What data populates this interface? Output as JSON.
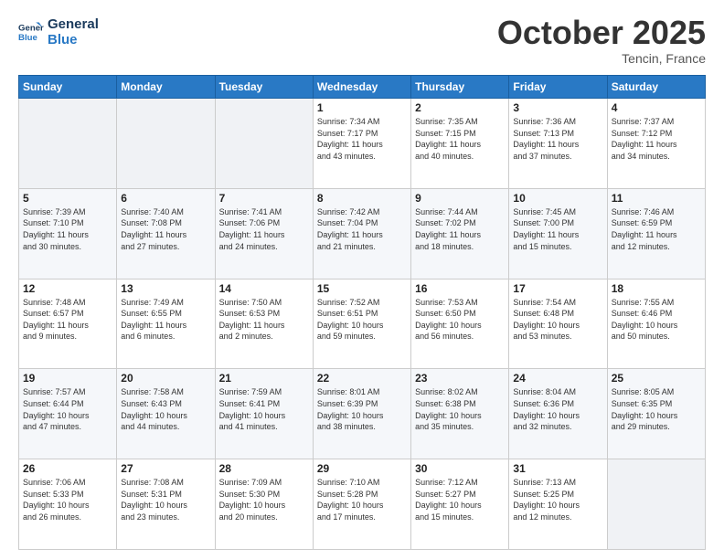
{
  "logo": {
    "line1": "General",
    "line2": "Blue"
  },
  "header": {
    "month": "October 2025",
    "location": "Tencin, France"
  },
  "weekdays": [
    "Sunday",
    "Monday",
    "Tuesday",
    "Wednesday",
    "Thursday",
    "Friday",
    "Saturday"
  ],
  "weeks": [
    [
      {
        "day": "",
        "info": ""
      },
      {
        "day": "",
        "info": ""
      },
      {
        "day": "",
        "info": ""
      },
      {
        "day": "1",
        "info": "Sunrise: 7:34 AM\nSunset: 7:17 PM\nDaylight: 11 hours\nand 43 minutes."
      },
      {
        "day": "2",
        "info": "Sunrise: 7:35 AM\nSunset: 7:15 PM\nDaylight: 11 hours\nand 40 minutes."
      },
      {
        "day": "3",
        "info": "Sunrise: 7:36 AM\nSunset: 7:13 PM\nDaylight: 11 hours\nand 37 minutes."
      },
      {
        "day": "4",
        "info": "Sunrise: 7:37 AM\nSunset: 7:12 PM\nDaylight: 11 hours\nand 34 minutes."
      }
    ],
    [
      {
        "day": "5",
        "info": "Sunrise: 7:39 AM\nSunset: 7:10 PM\nDaylight: 11 hours\nand 30 minutes."
      },
      {
        "day": "6",
        "info": "Sunrise: 7:40 AM\nSunset: 7:08 PM\nDaylight: 11 hours\nand 27 minutes."
      },
      {
        "day": "7",
        "info": "Sunrise: 7:41 AM\nSunset: 7:06 PM\nDaylight: 11 hours\nand 24 minutes."
      },
      {
        "day": "8",
        "info": "Sunrise: 7:42 AM\nSunset: 7:04 PM\nDaylight: 11 hours\nand 21 minutes."
      },
      {
        "day": "9",
        "info": "Sunrise: 7:44 AM\nSunset: 7:02 PM\nDaylight: 11 hours\nand 18 minutes."
      },
      {
        "day": "10",
        "info": "Sunrise: 7:45 AM\nSunset: 7:00 PM\nDaylight: 11 hours\nand 15 minutes."
      },
      {
        "day": "11",
        "info": "Sunrise: 7:46 AM\nSunset: 6:59 PM\nDaylight: 11 hours\nand 12 minutes."
      }
    ],
    [
      {
        "day": "12",
        "info": "Sunrise: 7:48 AM\nSunset: 6:57 PM\nDaylight: 11 hours\nand 9 minutes."
      },
      {
        "day": "13",
        "info": "Sunrise: 7:49 AM\nSunset: 6:55 PM\nDaylight: 11 hours\nand 6 minutes."
      },
      {
        "day": "14",
        "info": "Sunrise: 7:50 AM\nSunset: 6:53 PM\nDaylight: 11 hours\nand 2 minutes."
      },
      {
        "day": "15",
        "info": "Sunrise: 7:52 AM\nSunset: 6:51 PM\nDaylight: 10 hours\nand 59 minutes."
      },
      {
        "day": "16",
        "info": "Sunrise: 7:53 AM\nSunset: 6:50 PM\nDaylight: 10 hours\nand 56 minutes."
      },
      {
        "day": "17",
        "info": "Sunrise: 7:54 AM\nSunset: 6:48 PM\nDaylight: 10 hours\nand 53 minutes."
      },
      {
        "day": "18",
        "info": "Sunrise: 7:55 AM\nSunset: 6:46 PM\nDaylight: 10 hours\nand 50 minutes."
      }
    ],
    [
      {
        "day": "19",
        "info": "Sunrise: 7:57 AM\nSunset: 6:44 PM\nDaylight: 10 hours\nand 47 minutes."
      },
      {
        "day": "20",
        "info": "Sunrise: 7:58 AM\nSunset: 6:43 PM\nDaylight: 10 hours\nand 44 minutes."
      },
      {
        "day": "21",
        "info": "Sunrise: 7:59 AM\nSunset: 6:41 PM\nDaylight: 10 hours\nand 41 minutes."
      },
      {
        "day": "22",
        "info": "Sunrise: 8:01 AM\nSunset: 6:39 PM\nDaylight: 10 hours\nand 38 minutes."
      },
      {
        "day": "23",
        "info": "Sunrise: 8:02 AM\nSunset: 6:38 PM\nDaylight: 10 hours\nand 35 minutes."
      },
      {
        "day": "24",
        "info": "Sunrise: 8:04 AM\nSunset: 6:36 PM\nDaylight: 10 hours\nand 32 minutes."
      },
      {
        "day": "25",
        "info": "Sunrise: 8:05 AM\nSunset: 6:35 PM\nDaylight: 10 hours\nand 29 minutes."
      }
    ],
    [
      {
        "day": "26",
        "info": "Sunrise: 7:06 AM\nSunset: 5:33 PM\nDaylight: 10 hours\nand 26 minutes."
      },
      {
        "day": "27",
        "info": "Sunrise: 7:08 AM\nSunset: 5:31 PM\nDaylight: 10 hours\nand 23 minutes."
      },
      {
        "day": "28",
        "info": "Sunrise: 7:09 AM\nSunset: 5:30 PM\nDaylight: 10 hours\nand 20 minutes."
      },
      {
        "day": "29",
        "info": "Sunrise: 7:10 AM\nSunset: 5:28 PM\nDaylight: 10 hours\nand 17 minutes."
      },
      {
        "day": "30",
        "info": "Sunrise: 7:12 AM\nSunset: 5:27 PM\nDaylight: 10 hours\nand 15 minutes."
      },
      {
        "day": "31",
        "info": "Sunrise: 7:13 AM\nSunset: 5:25 PM\nDaylight: 10 hours\nand 12 minutes."
      },
      {
        "day": "",
        "info": ""
      }
    ]
  ]
}
